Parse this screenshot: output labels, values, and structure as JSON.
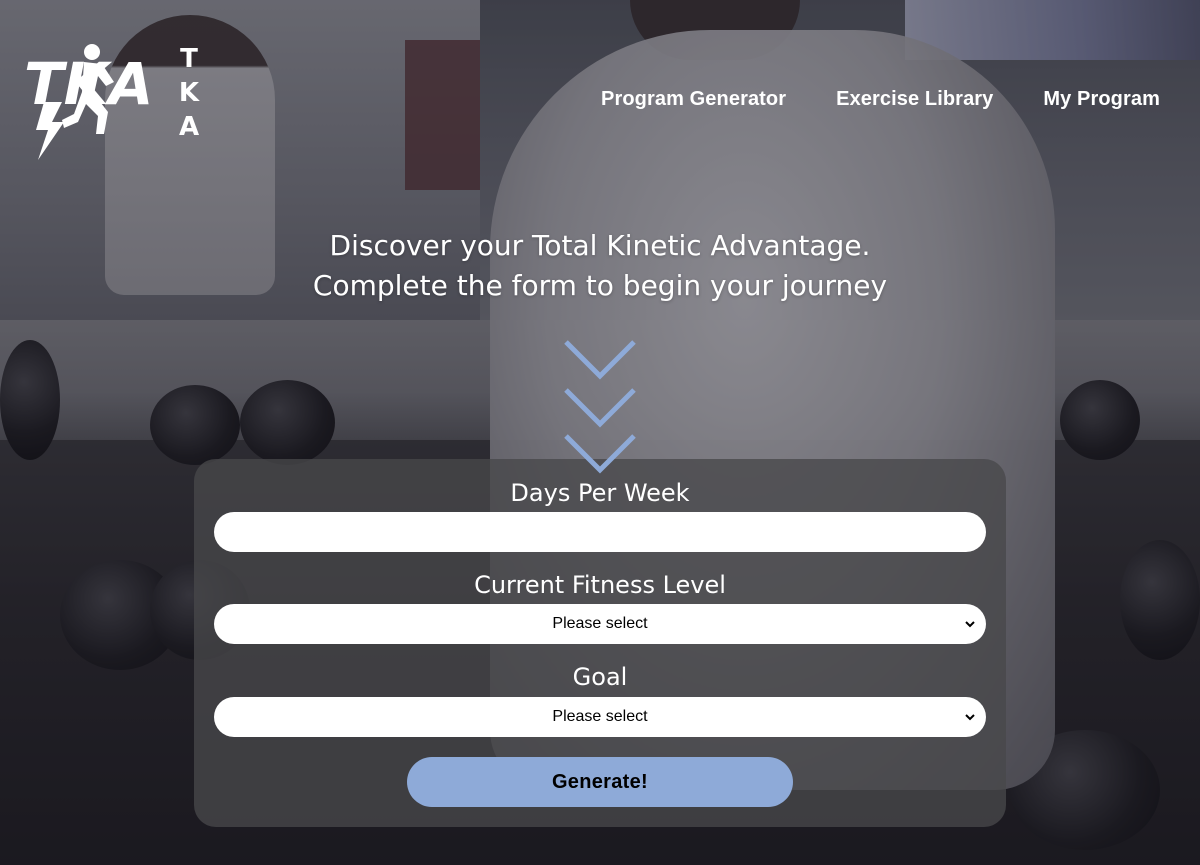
{
  "brand": {
    "logo_mark": "TKA",
    "letters": [
      "T",
      "K",
      "A"
    ]
  },
  "nav": {
    "items": [
      {
        "label": "Program Generator"
      },
      {
        "label": "Exercise Library"
      },
      {
        "label": "My Program"
      }
    ]
  },
  "hero": {
    "line1": "Discover your Total Kinetic Advantage.",
    "line2": "Complete the form to begin your journey"
  },
  "form": {
    "days_label": "Days Per Week",
    "days_value": "",
    "fitness_label": "Current Fitness Level",
    "fitness_selected": "Please select",
    "goal_label": "Goal",
    "goal_selected": "Please select",
    "submit_label": "Generate!"
  },
  "colors": {
    "accent": "#8eaad8",
    "card": "#48484a"
  },
  "icons": [
    "logo-runner-icon",
    "chevron-down-icon",
    "select-caret-icon"
  ]
}
